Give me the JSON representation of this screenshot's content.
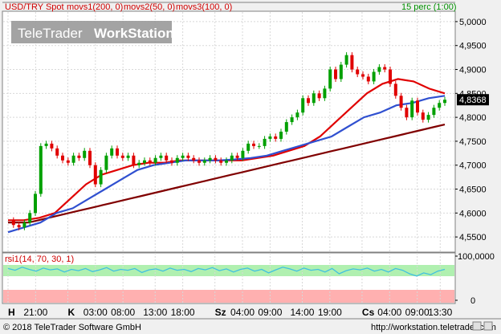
{
  "header": {
    "symbol_label": "USD/TRY Spot",
    "mov1_label": "movs1(200, 0)",
    "mov2_label": "movs2(50, 0)",
    "mov3_label": "movs3(100, 0)",
    "period_label": "15 perc (1:00)"
  },
  "watermark": {
    "brand": "TeleTrader",
    "product": "WorkStation"
  },
  "indicator": {
    "label": "rsi1(14, 70, 30, 1)"
  },
  "footer": {
    "copyright": "© 2018 TeleTrader Software GmbH",
    "url": "http://workstation.teletrader.com"
  },
  "colors": {
    "candle_up": "#00a000",
    "candle_down": "#e00000",
    "mov1": "#800000",
    "mov2": "#e00000",
    "mov3": "#3050d0",
    "rsi": "#40c0e0",
    "overbought_band": "#b0f0b0",
    "oversold_band": "#ffb0b0",
    "header_text": "#d00000",
    "period_text": "#009000"
  },
  "chart_data": [
    {
      "type": "line",
      "subtype": "candlestick",
      "ylim": [
        4.52,
        5.02
      ],
      "yticks": [
        4.55,
        4.6,
        4.65,
        4.7,
        4.75,
        4.8,
        4.85,
        4.9,
        4.95,
        5.0
      ],
      "ytick_labels": [
        "4,5500",
        "4,6000",
        "4,6500",
        "4,7000",
        "4,7500",
        "4,8000",
        "4,8500",
        "4,9000",
        "4,9500",
        "5,0000"
      ],
      "last_value": "4,8368",
      "xtick_labels": [
        "H",
        "21:00",
        "K",
        "03:00",
        "08:00",
        "13:00",
        "18:00",
        "Sz",
        "04:00",
        "09:00",
        "14:00",
        "19:00",
        "Cs",
        "04:00",
        "09:00",
        "13:30"
      ],
      "xtick_positions": [
        0,
        6,
        13,
        19,
        25,
        32,
        38,
        45,
        51,
        57,
        64,
        70,
        77,
        83,
        89,
        94
      ],
      "grid": true,
      "series": [
        {
          "name": "USD/TRY Spot",
          "values": [
            4.585,
            4.575,
            4.57,
            4.58,
            4.6,
            4.64,
            4.74,
            4.745,
            4.735,
            4.72,
            4.71,
            4.705,
            4.72,
            4.715,
            4.73,
            4.7,
            4.66,
            4.69,
            4.72,
            4.735,
            4.72,
            4.715,
            4.72,
            4.7,
            4.705,
            4.71,
            4.705,
            4.715,
            4.72,
            4.71,
            4.705,
            4.715,
            4.72,
            4.715,
            4.71,
            4.705,
            4.71,
            4.715,
            4.71,
            4.705,
            4.71,
            4.72,
            4.715,
            4.73,
            4.745,
            4.74,
            4.74,
            4.755,
            4.76,
            4.755,
            4.77,
            4.79,
            4.8,
            4.81,
            4.84,
            4.83,
            4.85,
            4.84,
            4.86,
            4.9,
            4.88,
            4.91,
            4.93,
            4.9,
            4.89,
            4.885,
            4.875,
            4.895,
            4.905,
            4.9,
            4.87,
            4.845,
            4.82,
            4.8,
            4.835,
            4.81,
            4.795,
            4.805,
            4.82,
            4.83,
            4.8368
          ]
        },
        {
          "name": "movs1(200, 0)",
          "values": [
            4.58,
            4.58,
            4.58,
            4.585,
            4.59,
            4.595,
            4.6,
            4.605,
            4.61,
            4.615,
            4.62,
            4.625,
            4.63,
            4.635,
            4.64,
            4.645,
            4.65,
            4.655,
            4.66,
            4.665,
            4.67,
            4.675,
            4.68,
            4.685,
            4.69,
            4.695,
            4.7,
            4.705,
            4.71,
            4.715,
            4.72,
            4.725,
            4.73,
            4.735,
            4.74,
            4.745,
            4.75,
            4.755,
            4.76,
            4.765,
            4.77,
            4.775,
            4.78,
            4.785
          ]
        },
        {
          "name": "movs2(50, 0)",
          "values": [
            4.585,
            4.585,
            4.59,
            4.6,
            4.63,
            4.66,
            4.68,
            4.69,
            4.7,
            4.705,
            4.705,
            4.71,
            4.71,
            4.71,
            4.71,
            4.71,
            4.715,
            4.72,
            4.73,
            4.74,
            4.76,
            4.79,
            4.82,
            4.85,
            4.87,
            4.88,
            4.875,
            4.86,
            4.85
          ]
        },
        {
          "name": "movs3(100, 0)",
          "values": [
            4.56,
            4.57,
            4.58,
            4.6,
            4.61,
            4.63,
            4.65,
            4.67,
            4.69,
            4.7,
            4.705,
            4.71,
            4.71,
            4.71,
            4.712,
            4.715,
            4.72,
            4.73,
            4.74,
            4.75,
            4.76,
            4.78,
            4.8,
            4.81,
            4.825,
            4.83,
            4.84,
            4.845
          ]
        }
      ]
    },
    {
      "type": "line",
      "title": "rsi1(14, 70, 30, 1)",
      "ylim": [
        0,
        100
      ],
      "yticks": [
        0,
        100
      ],
      "ytick_labels": [
        "0",
        "100,0000"
      ],
      "bands": {
        "overbought": 70,
        "oversold": 30
      },
      "series": [
        {
          "name": "rsi1",
          "values": [
            72,
            68,
            75,
            70,
            66,
            73,
            69,
            71,
            64,
            70,
            67,
            72,
            65,
            69,
            74,
            66,
            70,
            68,
            72,
            63,
            69,
            71,
            66,
            73,
            68,
            70,
            65,
            72,
            69,
            74,
            67,
            71,
            64,
            70,
            73,
            66,
            70,
            62,
            69,
            75,
            71,
            66,
            73,
            68,
            70,
            64,
            72,
            60,
            67,
            71,
            69,
            73,
            66,
            70,
            64,
            72,
            68,
            60,
            55,
            62,
            58,
            66,
            70
          ]
        }
      ]
    }
  ]
}
